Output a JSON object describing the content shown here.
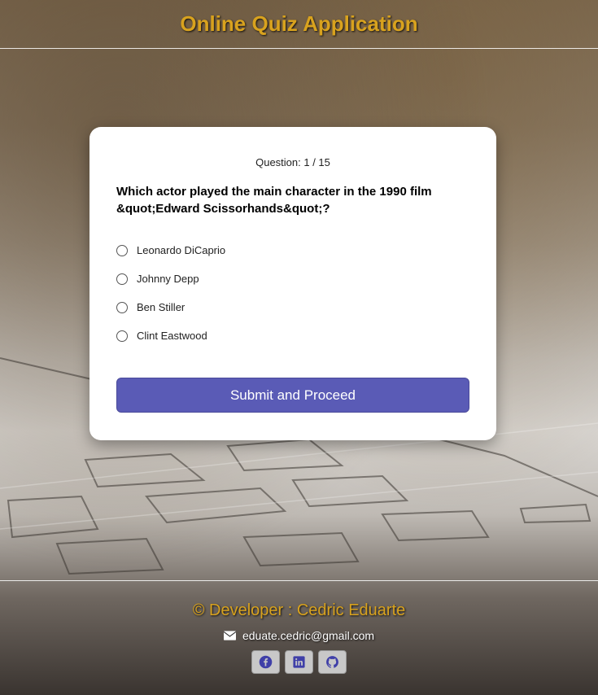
{
  "header": {
    "title": "Online Quiz Application"
  },
  "quiz": {
    "progress": "Question: 1 / 15",
    "question": "Which actor played the main character in the 1990 film &quot;Edward Scissorhands&quot;?",
    "options": [
      {
        "label": "Leonardo DiCaprio"
      },
      {
        "label": "Johnny Depp"
      },
      {
        "label": "Ben Stiller"
      },
      {
        "label": "Clint Eastwood"
      }
    ],
    "submit_label": "Submit and Proceed"
  },
  "footer": {
    "developer": "© Developer : Cedric Eduarte",
    "email": "eduate.cedric@gmail.com",
    "socials": [
      {
        "icon": "facebook-icon"
      },
      {
        "icon": "linkedin-icon"
      },
      {
        "icon": "github-icon"
      }
    ]
  },
  "colors": {
    "accent_gold": "#d8a21e",
    "button_primary": "#5a5bb6",
    "social_icon": "#3f3fa8"
  }
}
